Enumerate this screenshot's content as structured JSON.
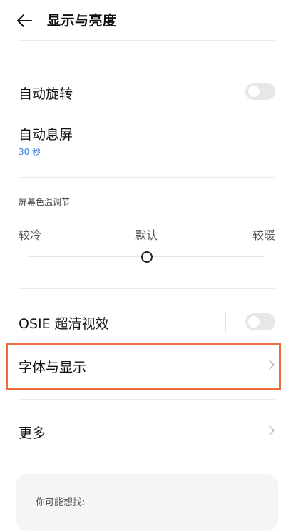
{
  "header": {
    "title": "显示与亮度"
  },
  "settings": {
    "auto_rotate": {
      "label": "自动旋转",
      "enabled": false
    },
    "auto_screen_off": {
      "label": "自动息屏",
      "value": "30 秒"
    },
    "color_temperature": {
      "label": "屏幕色温调节",
      "left": "较冷",
      "center": "默认",
      "right": "较暖",
      "slider_position": 0.5
    },
    "osie": {
      "label": "OSIE 超清视效",
      "enabled": false
    },
    "font_display": {
      "label": "字体与显示"
    },
    "more": {
      "label": "更多"
    }
  },
  "suggestions": {
    "label": "你可能想找:"
  },
  "colors": {
    "accent": "#2f7de0",
    "highlight": "#ed6a3c"
  }
}
